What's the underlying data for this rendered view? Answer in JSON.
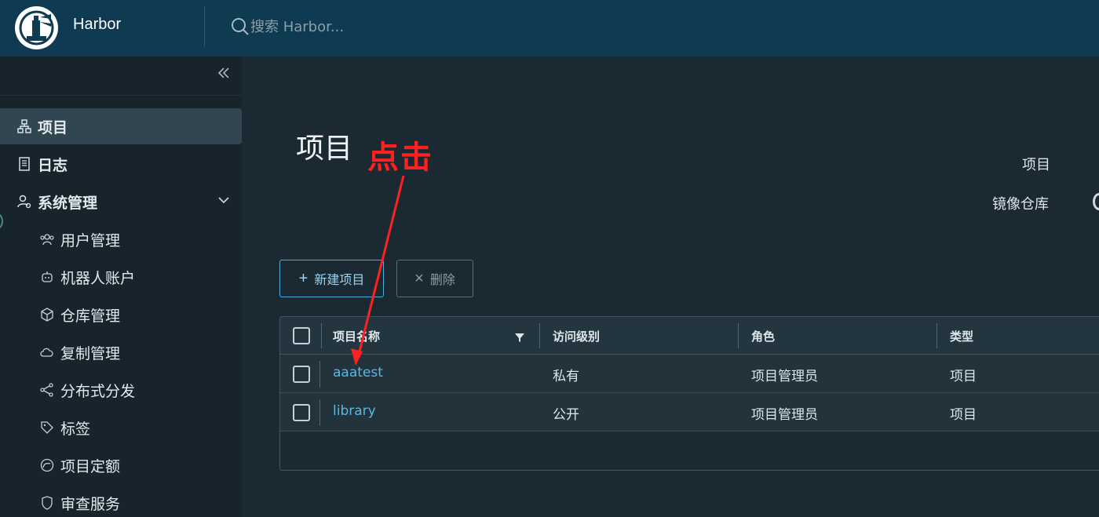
{
  "header": {
    "brand": "Harbor",
    "search_placeholder": "搜索 Harbor..."
  },
  "sidebar": {
    "items": [
      {
        "label": "项目",
        "icon": "project-icon",
        "active": true
      },
      {
        "label": "日志",
        "icon": "log-icon"
      },
      {
        "label": "系统管理",
        "icon": "admin-icon",
        "expanded": true
      },
      {
        "label": "用户管理",
        "icon": "users-icon"
      },
      {
        "label": "机器人账户",
        "icon": "robot-icon"
      },
      {
        "label": "仓库管理",
        "icon": "registry-icon"
      },
      {
        "label": "复制管理",
        "icon": "replication-icon"
      },
      {
        "label": "分布式分发",
        "icon": "share-icon"
      },
      {
        "label": "标签",
        "icon": "tag-icon"
      },
      {
        "label": "项目定额",
        "icon": "quota-icon"
      },
      {
        "label": "审查服务",
        "icon": "shield-icon"
      }
    ]
  },
  "main": {
    "title": "项目",
    "annotation": "点击",
    "stats": {
      "label1": "项目",
      "label2": "镜像仓库"
    },
    "toolbar": {
      "new_label": "新建项目",
      "delete_label": "删除"
    },
    "table": {
      "columns": [
        "项目名称",
        "访问级别",
        "角色",
        "类型"
      ],
      "rows": [
        {
          "name": "aaatest",
          "access": "私有",
          "role": "项目管理员",
          "type": "项目"
        },
        {
          "name": "library",
          "access": "公开",
          "role": "项目管理员",
          "type": "项目"
        }
      ]
    }
  },
  "colors": {
    "header": "#0e3a52",
    "accent": "#49afd9",
    "annotation": "#ff2020"
  }
}
